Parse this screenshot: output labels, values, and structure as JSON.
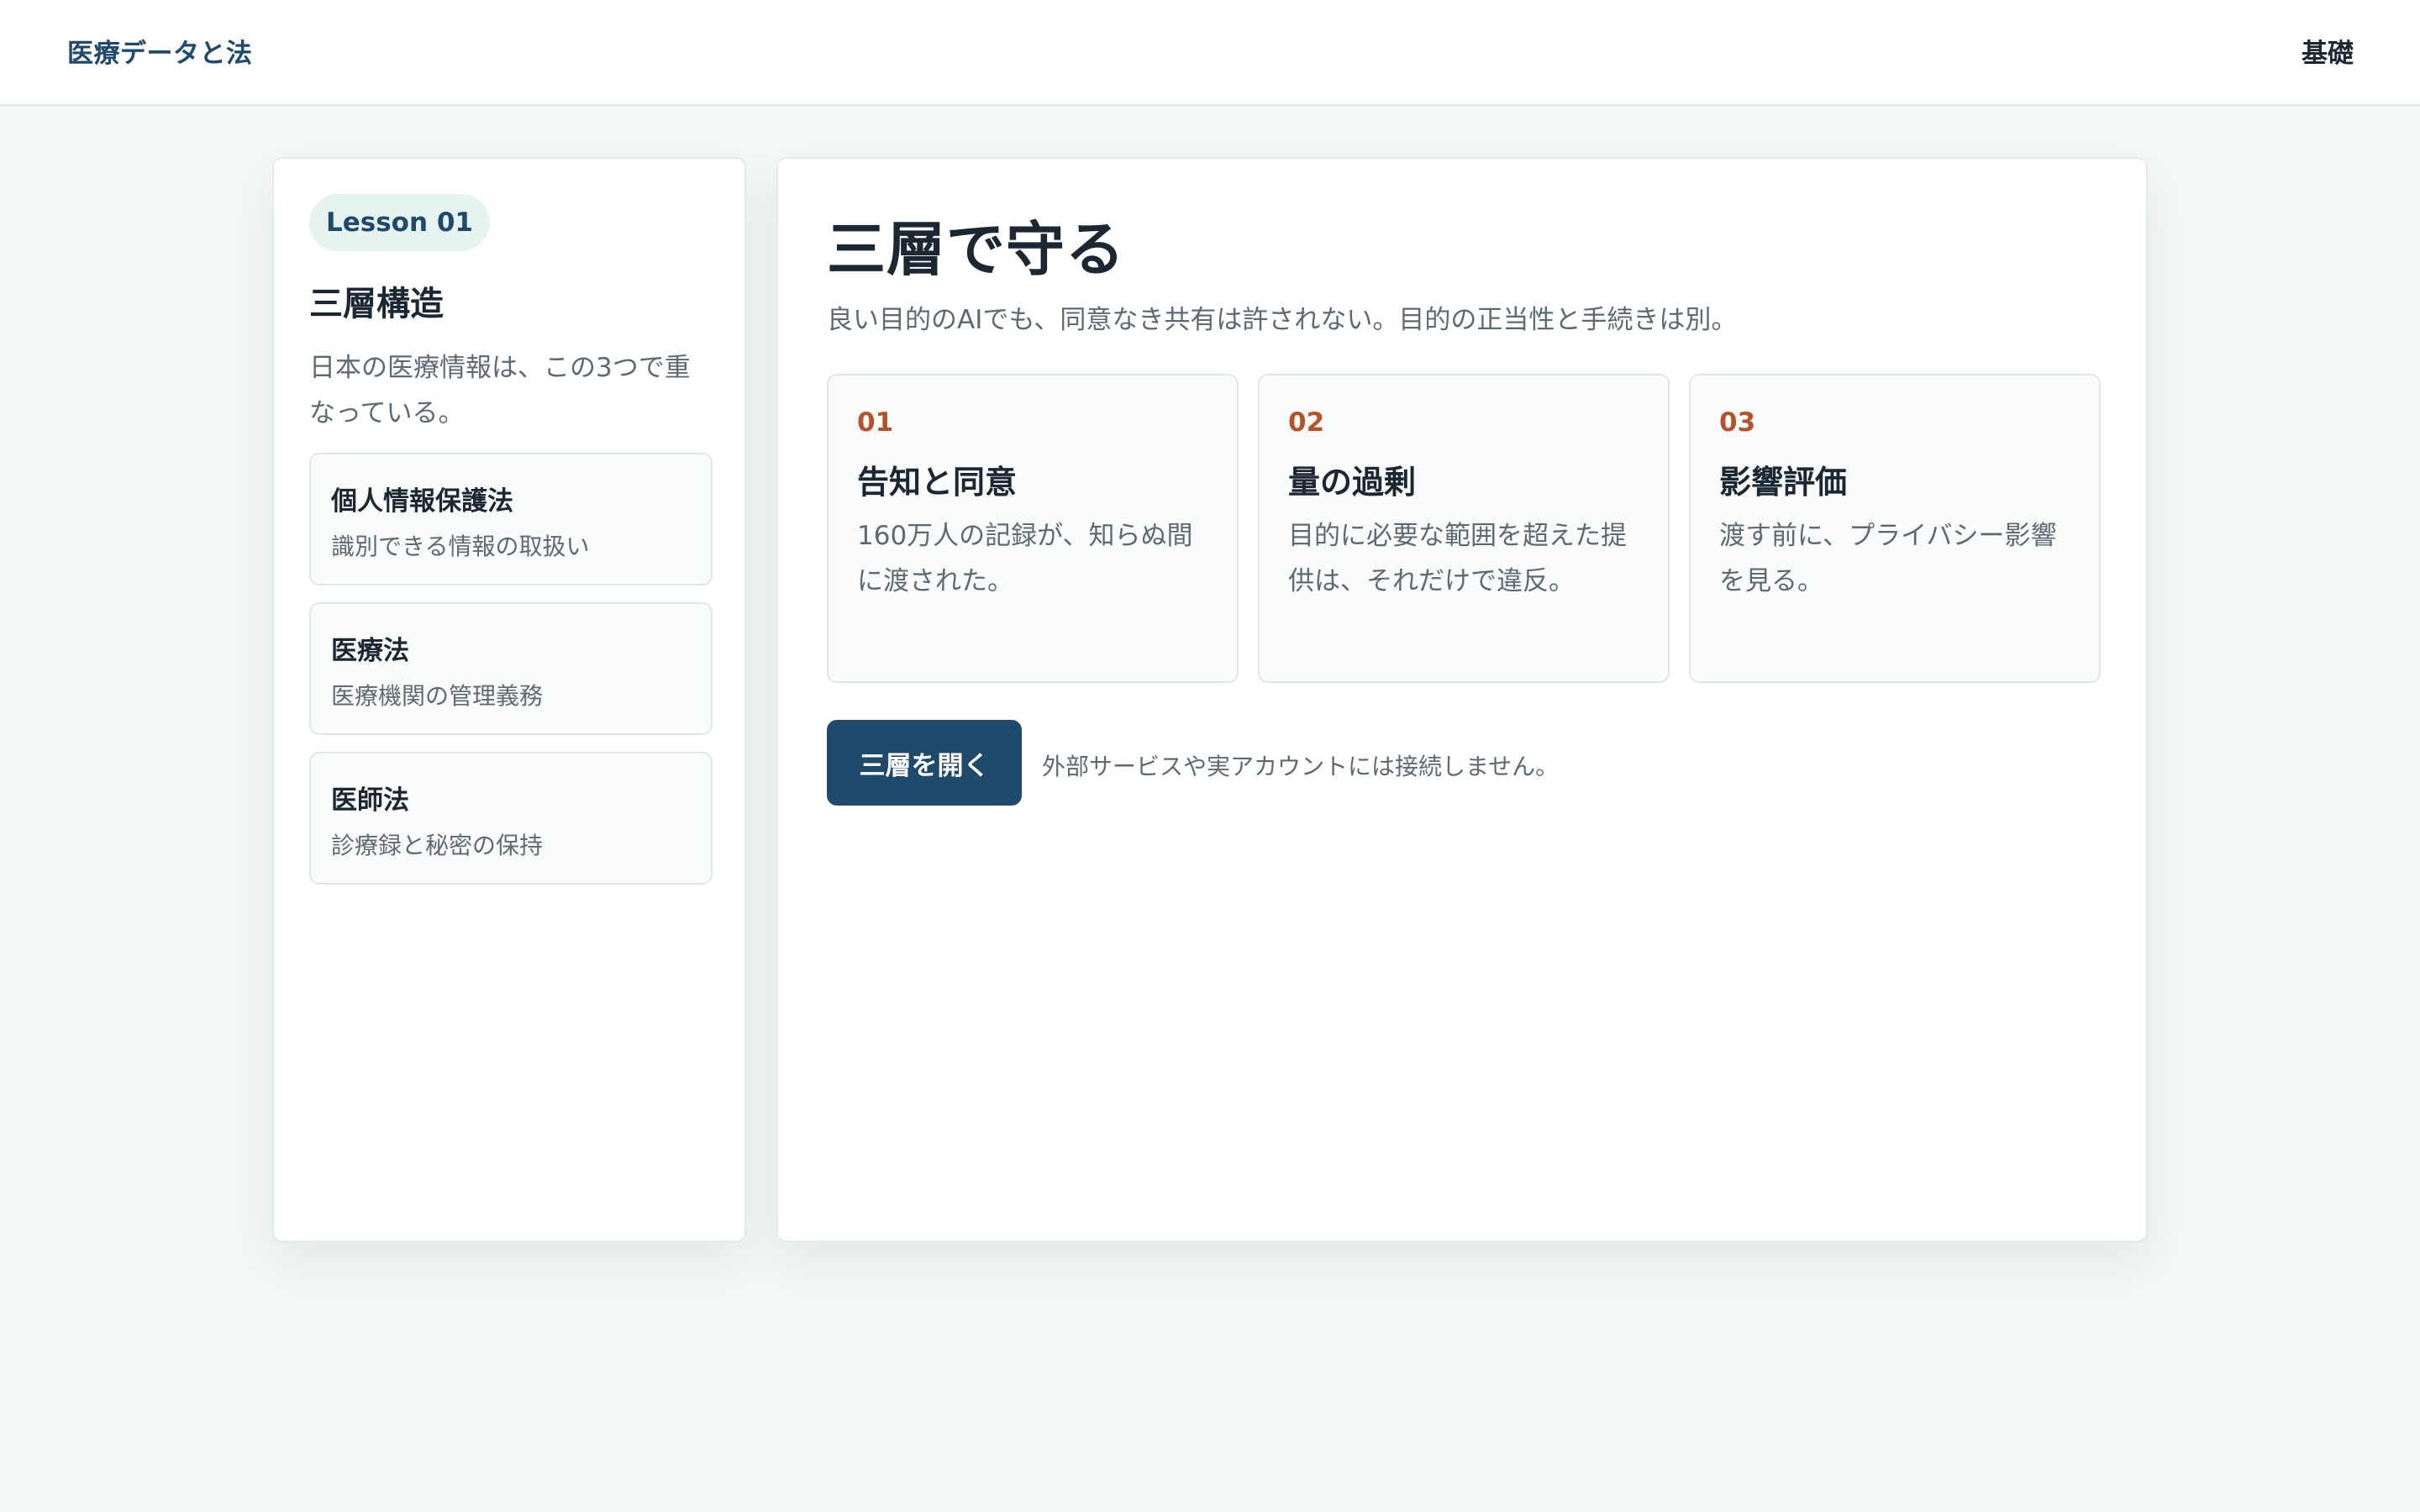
{
  "header": {
    "brand": "医療データと法",
    "nav_link": "基礎"
  },
  "sidebar": {
    "lesson_badge": "Lesson 01",
    "title": "三層構造",
    "description": "日本の医療情報は、この3つで重なっている。",
    "laws": [
      {
        "name": "個人情報保護法",
        "subtitle": "識別できる情報の取扱い"
      },
      {
        "name": "医療法",
        "subtitle": "医療機関の管理義務"
      },
      {
        "name": "医師法",
        "subtitle": "診療録と秘密の保持"
      }
    ]
  },
  "main": {
    "title": "三層で守る",
    "subtitle": "良い目的のAIでも、同意なき共有は許されない。目的の正当性と手続きは別。",
    "steps": [
      {
        "number": "01",
        "title": "告知と同意",
        "body": "160万人の記録が、知らぬ間に渡された。"
      },
      {
        "number": "02",
        "title": "量の過剰",
        "body": "目的に必要な範囲を超えた提供は、それだけで違反。"
      },
      {
        "number": "03",
        "title": "影響評価",
        "body": "渡す前に、プライバシー影響を見る。"
      }
    ],
    "action_button": "三層を開く",
    "action_note": "外部サービスや実アカウントには接続しません。"
  },
  "colors": {
    "brand": "#1f4a6b",
    "accent": "#b4522a",
    "background": "#f4f8f7",
    "pill_bg": "#e6f3f0"
  }
}
